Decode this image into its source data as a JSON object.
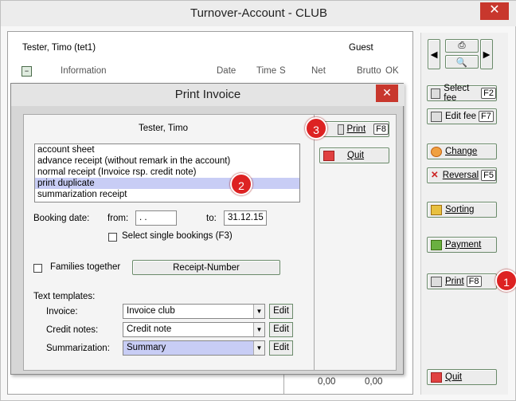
{
  "window": {
    "title": "Turnover-Account - CLUB",
    "close_icon": "close-icon"
  },
  "account": {
    "member": "Tester, Timo (tet1)",
    "user": "Guest",
    "columns": [
      "Information",
      "Date",
      "Time",
      "S",
      "Net",
      "Brutto",
      "OK"
    ],
    "net_total": "0,00",
    "brutto_total": "0,00"
  },
  "side_buttons": {
    "select_fee": {
      "label": "Select fee",
      "key": "F2"
    },
    "edit_fee": {
      "label": "Edit fee",
      "key": "F7"
    },
    "change": {
      "label": "Change"
    },
    "reversal": {
      "label": "Reversal",
      "key": "F5"
    },
    "sorting": {
      "label": "Sorting"
    },
    "payment": {
      "label": "Payment"
    },
    "print": {
      "label": "Print",
      "key": "F8"
    },
    "quit": {
      "label": "Quit"
    }
  },
  "dialog": {
    "title": "Print Invoice",
    "member": "Tester, Timo",
    "options": [
      "account sheet",
      "advance receipt (without remark in the account)",
      "normal receipt (Invoice rsp. credit note)",
      "print duplicate",
      "summarization receipt"
    ],
    "selected_index": 3,
    "booking_date_label": "Booking date:",
    "from_label": "from:",
    "from_value": " .  .",
    "to_label": "to:",
    "to_value": "31.12.15",
    "select_single_label": "Select single bookings (F3)",
    "families_label": "Families together",
    "receipt_number_label": "Receipt-Number",
    "text_templates_label": "Text templates:",
    "invoice_label": "Invoice:",
    "invoice_value": "Invoice club",
    "credit_label": "Credit notes:",
    "credit_value": "Credit note",
    "summary_label": "Summarization:",
    "summary_value": "Summary",
    "edit_label": "Edit",
    "print_label": "Print",
    "print_key": "F8",
    "quit_label": "Quit"
  },
  "badges": [
    "1",
    "2",
    "3"
  ],
  "colors": {
    "accent_red": "#cc2222",
    "selection": "#c8cdf5"
  }
}
